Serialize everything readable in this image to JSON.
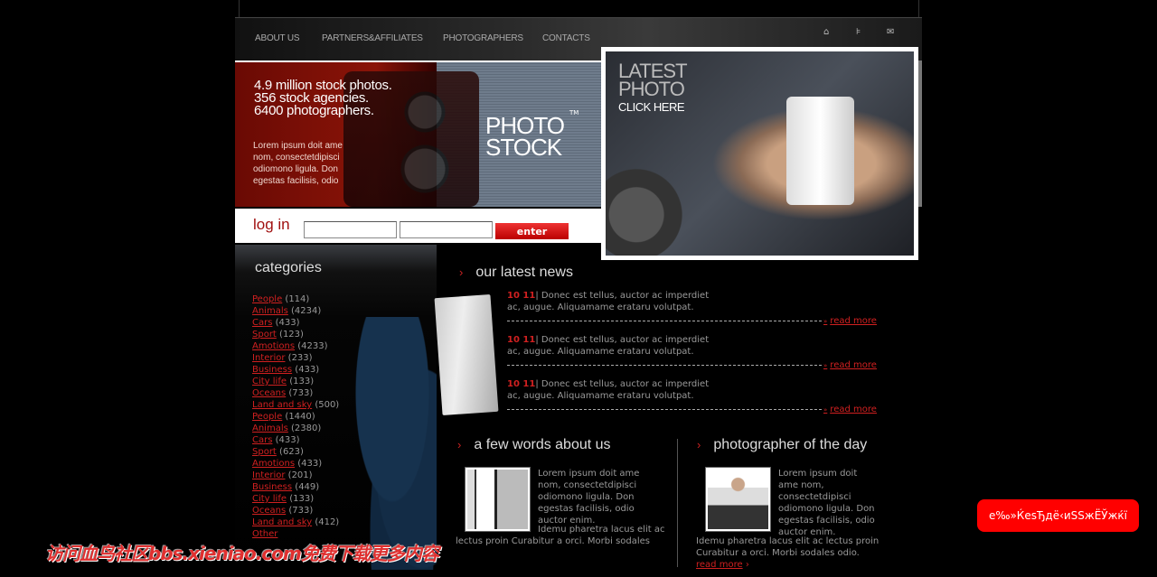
{
  "nav": {
    "items": [
      "ABOUT US",
      "PARTNERS&AFFILIATES",
      "PHOTOGRAPHERS",
      "CONTACTS"
    ],
    "icons": [
      "home-icon",
      "sitemap-icon",
      "mail-icon"
    ]
  },
  "banner": {
    "headline": [
      "4.9 million stock photos.",
      "356 stock agencies.",
      "6400 photographers."
    ],
    "blurb": "Lorem ipsum doit ame nom, consectetdipisci odiomono ligula. Don egestas facilisis, odio",
    "logo": [
      "PHOTO",
      "STOCK"
    ],
    "tm": "TM"
  },
  "login": {
    "label": "log in",
    "username": "",
    "password": "",
    "button": "enter"
  },
  "latest_photo": {
    "line1": "LATEST",
    "line2": "PHOTO",
    "cta": "CLICK HERE"
  },
  "categories": {
    "title": "categories",
    "items": [
      {
        "name": "People",
        "count": "(114)"
      },
      {
        "name": "Animals",
        "count": "(4234)"
      },
      {
        "name": "Cars",
        "count": "(433)"
      },
      {
        "name": "Sport",
        "count": "(123)"
      },
      {
        "name": "Amotions",
        "count": "(4233)"
      },
      {
        "name": "Interior",
        "count": "(233)"
      },
      {
        "name": "Business",
        "count": "(433)"
      },
      {
        "name": "City life",
        "count": "(133)"
      },
      {
        "name": "Oceans",
        "count": "(733)"
      },
      {
        "name": "Land and sky",
        "count": "(500)"
      },
      {
        "name": "People",
        "count": "(1440)"
      },
      {
        "name": "Animals",
        "count": "(2380)"
      },
      {
        "name": "Cars",
        "count": "(433)"
      },
      {
        "name": "Sport",
        "count": "(623)"
      },
      {
        "name": "Amotions",
        "count": "(433)"
      },
      {
        "name": "Interior",
        "count": "(201)"
      },
      {
        "name": "Business",
        "count": "(449)"
      },
      {
        "name": "City life",
        "count": "(133)"
      },
      {
        "name": "Oceans",
        "count": "(733)"
      },
      {
        "name": "Land and sky",
        "count": "(412)"
      },
      {
        "name": "Other",
        "count": ""
      }
    ]
  },
  "news": {
    "title": "our latest news",
    "arrow": "›",
    "read_more": "read more",
    "items": [
      {
        "date": "10 11",
        "text": "| Donec est tellus, auctor ac imperdiet ac, augue. Aliquamame erataru volutpat."
      },
      {
        "date": "10 11",
        "text": "| Donec est tellus, auctor ac imperdiet ac, augue. Aliquamame erataru volutpat."
      },
      {
        "date": "10 11",
        "text": "| Donec est tellus, auctor ac imperdiet ac, augue. Aliquamame erataru volutpat."
      }
    ]
  },
  "about": {
    "title": "a few words about us",
    "p1": "Lorem ipsum doit ame nom, consectetdipisci odiomono ligula. Don egestas facilisis, odio auctor enim.",
    "p2a": "Idemu pharetra lacus elit ac",
    "p2b": "lectus proin Curabitur a orci. Morbi sodales"
  },
  "photographer": {
    "title": "photographer of the day",
    "p1": "Lorem ipsum doit ame nom, consectetdipisci odiomono ligula. Don egestas facilisis, odio auctor enim.",
    "p2": "Idemu pharetra lacus elit ac lectus proin Curabitur a orci. Morbi sodales odio. ",
    "read": "read",
    "more": "more",
    "arrow": "›"
  },
  "watermark": "访问血鸟社区bbs.xieniao.com免费下载更多内容",
  "float_button": "e‰»ЌesЂдё‹иSSжЁЎжќї"
}
